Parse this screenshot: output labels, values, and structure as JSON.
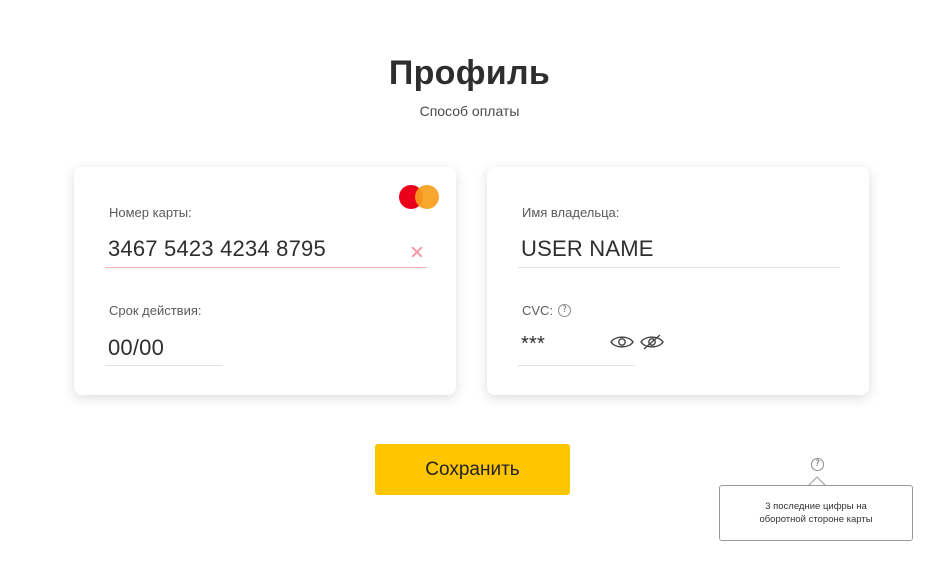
{
  "header": {
    "title": "Профиль",
    "subtitle": "Способ оплаты"
  },
  "card_left": {
    "card_number_label": "Номер карты:",
    "card_number_value": "3467 5423 4234 8795",
    "expiry_label": "Срок действия:",
    "expiry_value": "00/00",
    "brand_icon": "mastercard-logo"
  },
  "card_right": {
    "holder_label": "Имя владельца:",
    "holder_value": "USER NAME",
    "cvc_label": "CVC:",
    "cvc_value": "***",
    "help_glyph": "?"
  },
  "actions": {
    "save_label": "Сохранить"
  },
  "tooltip": {
    "glyph": "?",
    "text": "3 последние цифры на оборотной стороне карты"
  },
  "colors": {
    "accent_button": "#ffc600",
    "active_underline": "#f4b0b6",
    "clear_icon": "#f29aa2",
    "mastercard_red": "#eb001b",
    "mastercard_orange": "#f79e1b"
  }
}
